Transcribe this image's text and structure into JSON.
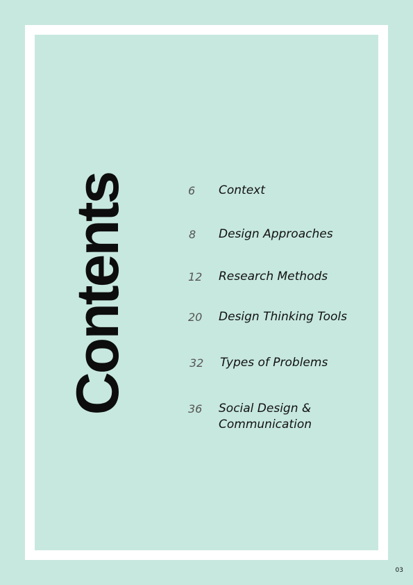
{
  "page": {
    "background_color": "#c7e8df",
    "frame_color": "#ffffff",
    "title": "Contents",
    "page_number": "03"
  },
  "toc": [
    {
      "number": "6",
      "title_lines": [
        "Context"
      ]
    },
    {
      "number": "8",
      "title_lines": [
        "Design Approaches"
      ]
    },
    {
      "number": "12",
      "title_lines": [
        "Research Methods"
      ]
    },
    {
      "number": "20",
      "title_lines": [
        "Design Thinking Tools"
      ]
    },
    {
      "number": "32",
      "title_lines": [
        "Types of Problems"
      ]
    },
    {
      "number": "36",
      "title_lines": [
        "Social Design &",
        "Communication"
      ]
    }
  ]
}
